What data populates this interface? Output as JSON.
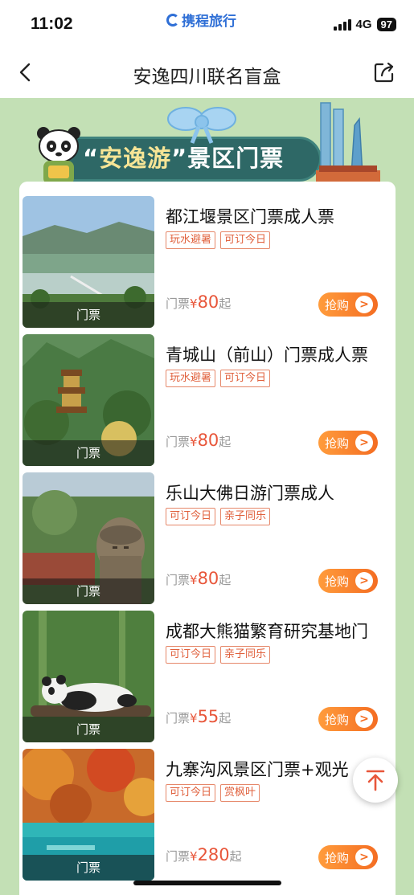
{
  "status": {
    "time": "11:02",
    "brand": "携程旅行",
    "network": "4G",
    "battery": "97"
  },
  "nav": {
    "title": "安逸四川联名盲盒",
    "back_icon": "chevron-left-icon",
    "share_icon": "share-icon"
  },
  "banner": {
    "quote_open": "“",
    "highlight": "安逸游",
    "quote_close": "”",
    "rest": "景区门票"
  },
  "items": [
    {
      "title": "都江堰景区门票成人票",
      "tags": [
        "玩水避暑",
        "可订今日"
      ],
      "label": "门票",
      "price_prefix": "门票",
      "currency": "¥",
      "price": "80",
      "price_suffix": "起",
      "button": "抢购"
    },
    {
      "title": "青城山（前山）门票成人票",
      "tags": [
        "玩水避暑",
        "可订今日"
      ],
      "label": "门票",
      "price_prefix": "门票",
      "currency": "¥",
      "price": "80",
      "price_suffix": "起",
      "button": "抢购"
    },
    {
      "title": "乐山大佛日游门票成人",
      "tags": [
        "可订今日",
        "亲子同乐"
      ],
      "label": "门票",
      "price_prefix": "门票",
      "currency": "¥",
      "price": "80",
      "price_suffix": "起",
      "button": "抢购"
    },
    {
      "title": "成都大熊猫繁育研究基地门",
      "tags": [
        "可订今日",
        "亲子同乐"
      ],
      "label": "门票",
      "price_prefix": "门票",
      "currency": "¥",
      "price": "55",
      "price_suffix": "起",
      "button": "抢购"
    },
    {
      "title": "九寨沟风景区门票+观光",
      "tags": [
        "可订今日",
        "赏枫叶"
      ],
      "label": "门票",
      "price_prefix": "门票",
      "currency": "¥",
      "price": "280",
      "price_suffix": "起",
      "button": "抢购"
    }
  ],
  "buy_arrow": ">",
  "fab_icon": "arrow-up-to-top-icon",
  "colors": {
    "background_green": "#c3e0b5",
    "price_red": "#e8563a",
    "button_orange": "#f46d22"
  }
}
